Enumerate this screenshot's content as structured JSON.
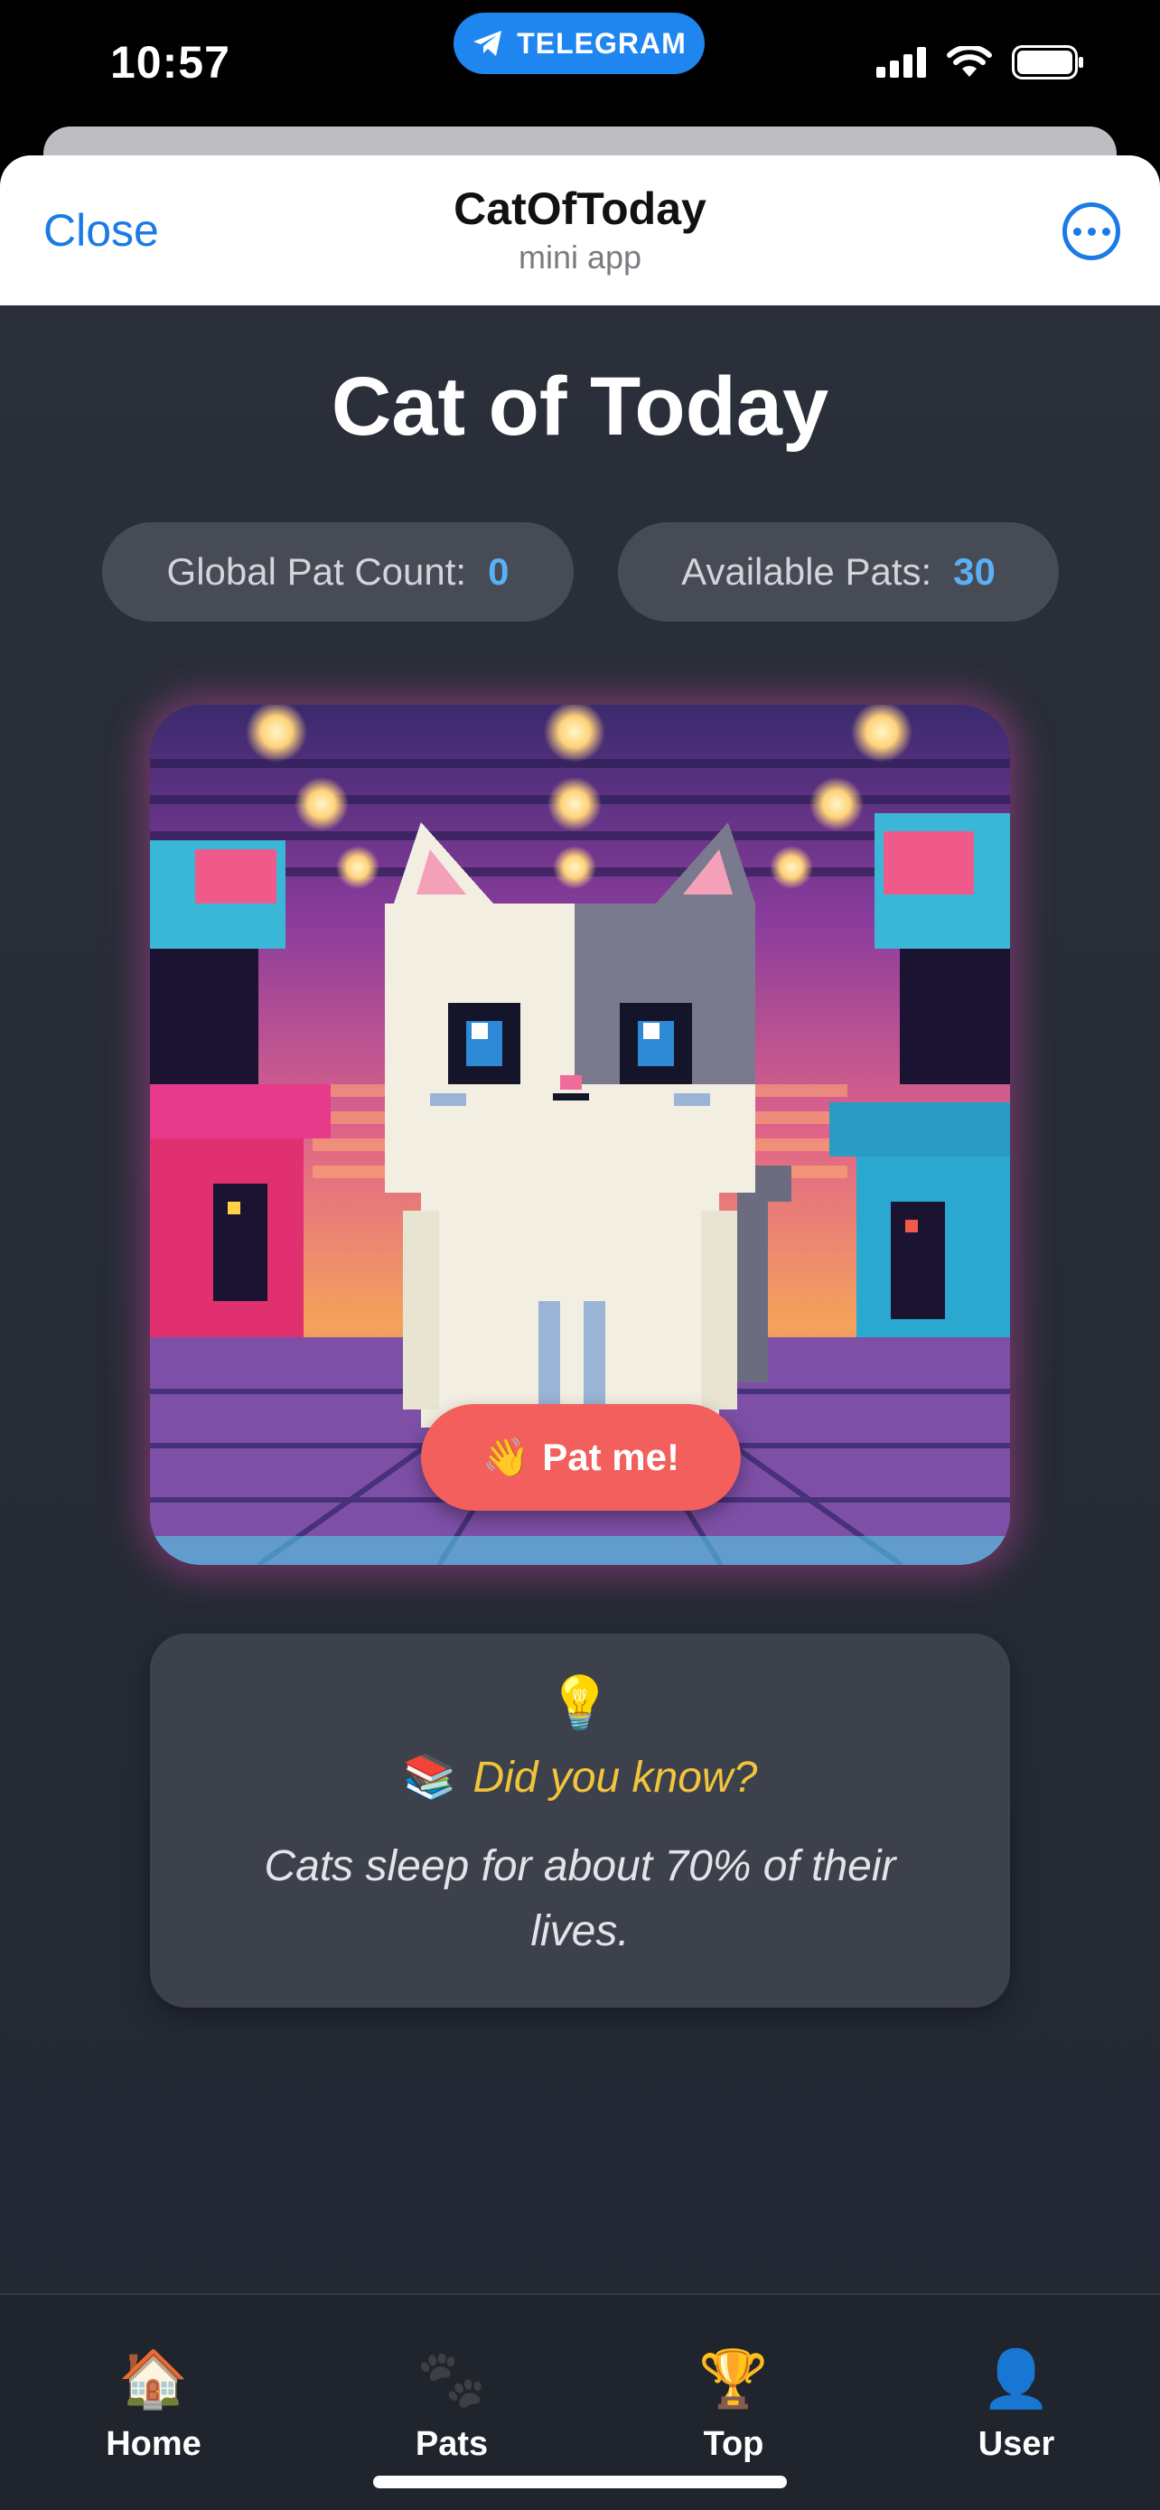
{
  "status_bar": {
    "time": "10:57",
    "telegram_label": "TELEGRAM"
  },
  "header": {
    "close_label": "Close",
    "title": "CatOfToday",
    "subtitle": "mini app",
    "more_icon": "ellipsis-circle-icon"
  },
  "main": {
    "title": "Cat of Today",
    "stats": {
      "global_label": "Global Pat Count:",
      "global_value": "0",
      "available_label": "Available Pats:",
      "available_value": "30"
    },
    "pat_button": {
      "icon": "👋",
      "label": "Pat me!"
    },
    "fact": {
      "bulb_icon": "💡",
      "books_icon": "📚",
      "heading": "Did you know?",
      "text": "Cats sleep for about 70% of their lives."
    }
  },
  "tabs": [
    {
      "label": "Home",
      "icon": "🏠"
    },
    {
      "label": "Pats",
      "icon": "🐾"
    },
    {
      "label": "Top",
      "icon": "🏆"
    },
    {
      "label": "User",
      "icon": "👤"
    }
  ],
  "colors": {
    "accent_blue": "#1a7ae6",
    "telegram_blue": "#1f86f0",
    "pat_button": "#f25f5c",
    "stat_value": "#5ab0f5",
    "fact_heading": "#f2c43b",
    "background": "#262b35"
  }
}
